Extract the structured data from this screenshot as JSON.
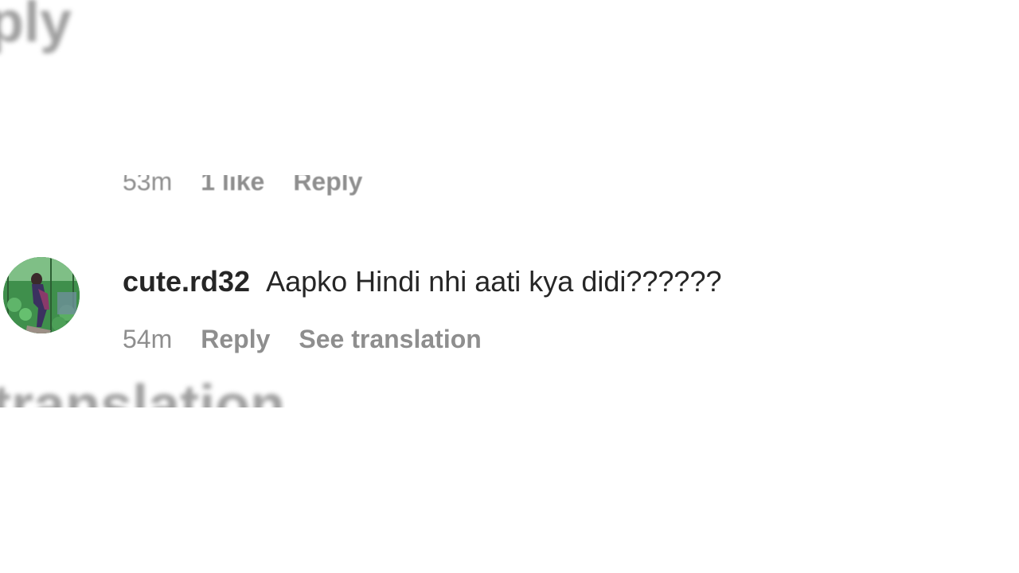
{
  "background_fragments": {
    "top_text": "ply",
    "bottom_text": "e translation"
  },
  "previous_comment": {
    "time": "53m",
    "likes": "1 like",
    "reply_label": "Reply"
  },
  "comment": {
    "avatar_icon": "user-avatar-photo",
    "username": "cute.rd32",
    "text": "Aapko Hindi nhi aati kya didi??????",
    "time": "54m",
    "reply_label": "Reply",
    "translate_label": "See translation"
  },
  "colors": {
    "primary_text": "#262626",
    "secondary_text": "#8e8e8e",
    "background": "#ffffff"
  }
}
